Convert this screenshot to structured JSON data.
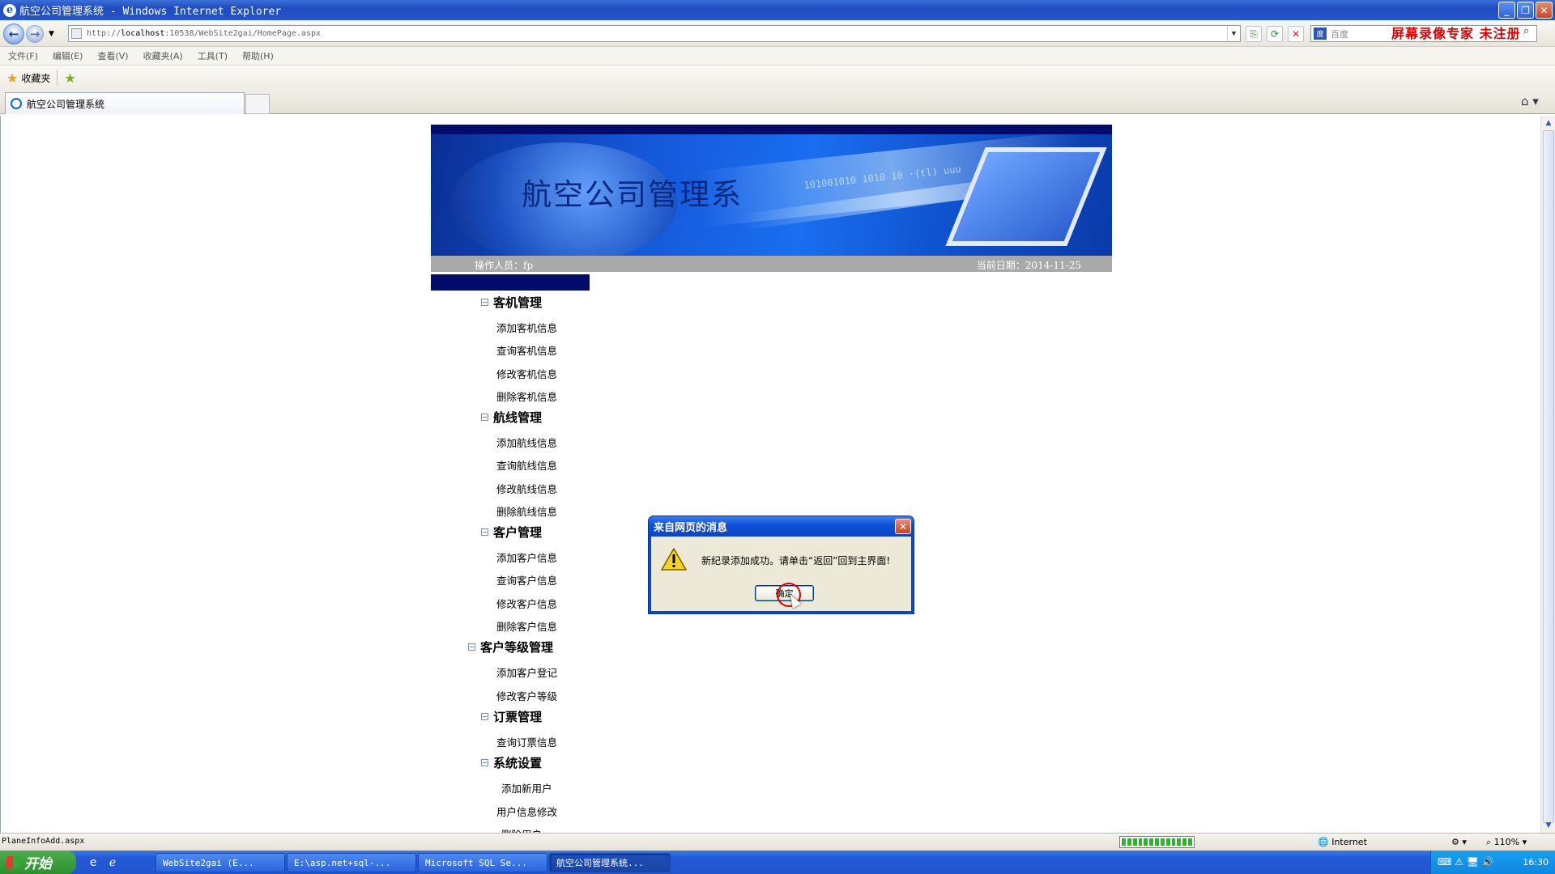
{
  "window": {
    "title": "航空公司管理系统 - Windows Internet Explorer"
  },
  "address_bar": {
    "url_prefix": "http://",
    "url_host": "localhost",
    "url_rest": ":10538/WebSite2gai/HomePage.aspx",
    "search_placeholder": "百度",
    "watermark": "屏幕录像专家 未注册"
  },
  "menu": [
    "文件(F)",
    "编辑(E)",
    "查看(V)",
    "收藏夹(A)",
    "工具(T)",
    "帮助(H)"
  ],
  "favorites": {
    "label": "收藏夹"
  },
  "tab": {
    "label": "航空公司管理系统"
  },
  "page": {
    "banner_title": "航空公司管理系",
    "banner_digits": "101001010 1010 10 ·(tl) uuu",
    "operator": "操作人员：fp",
    "date": "当前日期：2014-11-25",
    "nav_groups": [
      {
        "label": "客机管理",
        "items": [
          "添加客机信息",
          "查询客机信息",
          "修改客机信息",
          "删除客机信息"
        ]
      },
      {
        "label": "航线管理",
        "items": [
          "添加航线信息",
          "查询航线信息",
          "修改航线信息",
          "删除航线信息"
        ]
      },
      {
        "label": "客户管理",
        "items": [
          "添加客户信息",
          "查询客户信息",
          "修改客户信息",
          "删除客户信息"
        ]
      },
      {
        "label": "客户等级管理",
        "items": [
          "添加客户登记",
          "修改客户等级"
        ]
      },
      {
        "label": "订票管理",
        "items": [
          "查询订票信息"
        ]
      },
      {
        "label": "系统设置",
        "items": [
          "添加新用户",
          "用户信息修改",
          "删除用户"
        ]
      }
    ]
  },
  "dialog": {
    "title": "来自网页的消息",
    "message": "新纪录添加成功。请单击“返回”回到主界面!",
    "ok_label": "确定"
  },
  "status": {
    "text": "PlaneInfoAdd.aspx",
    "zone": "Internet",
    "zoom": "110%"
  },
  "taskbar": {
    "start": "开始",
    "tasks": [
      "WebSite2gai (E...",
      "E:\\asp.net+sql-...",
      "Microsoft SQL Se...",
      "航空公司管理系统..."
    ],
    "clock": "16:30"
  }
}
